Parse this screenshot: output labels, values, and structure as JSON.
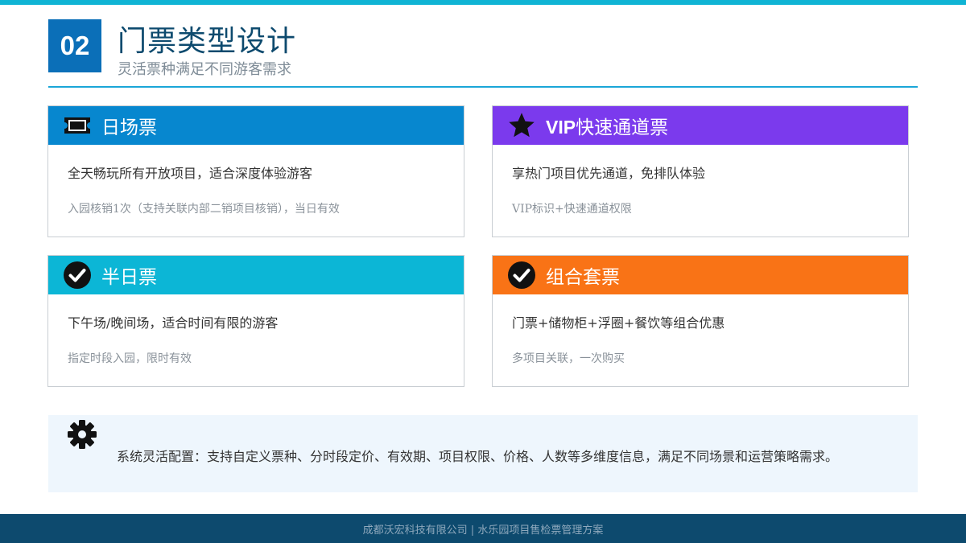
{
  "header": {
    "section_number": "02",
    "title": "门票类型设计",
    "subtitle": "灵活票种满足不同游客需求"
  },
  "cards": [
    {
      "icon": "ticket-icon",
      "title": "日场票",
      "description": "全天畅玩所有开放项目，适合深度体验游客",
      "note": "入园核销1次（支持关联内部二销项目核销），当日有效",
      "color": "#0787cf"
    },
    {
      "icon": "star-icon",
      "title_bold": "VIP",
      "title_rest": "快速通道票",
      "description": "享热门项目优先通道，免排队体验",
      "note": "VIP标识+快速通道权限",
      "color": "#7b3aed"
    },
    {
      "icon": "check-circle-icon",
      "title": "半日票",
      "description": "下午场/晚间场，适合时间有限的游客",
      "note": "指定时段入园，限时有效",
      "color": "#0cb6d6"
    },
    {
      "icon": "check-circle-icon",
      "title": "组合套票",
      "description": "门票+储物柜+浮圈+餐饮等组合优惠",
      "note": "多项目关联，一次购买",
      "color": "#f97316"
    }
  ],
  "config": {
    "icon": "gear-icon",
    "text": "系统灵活配置：支持自定义票种、分时段定价、有效期、项目权限、价格、人数等多维度信息，满足不同场景和运营策略需求。"
  },
  "footer": {
    "text": "成都沃宏科技有限公司 | 水乐园项目售检票管理方案"
  }
}
